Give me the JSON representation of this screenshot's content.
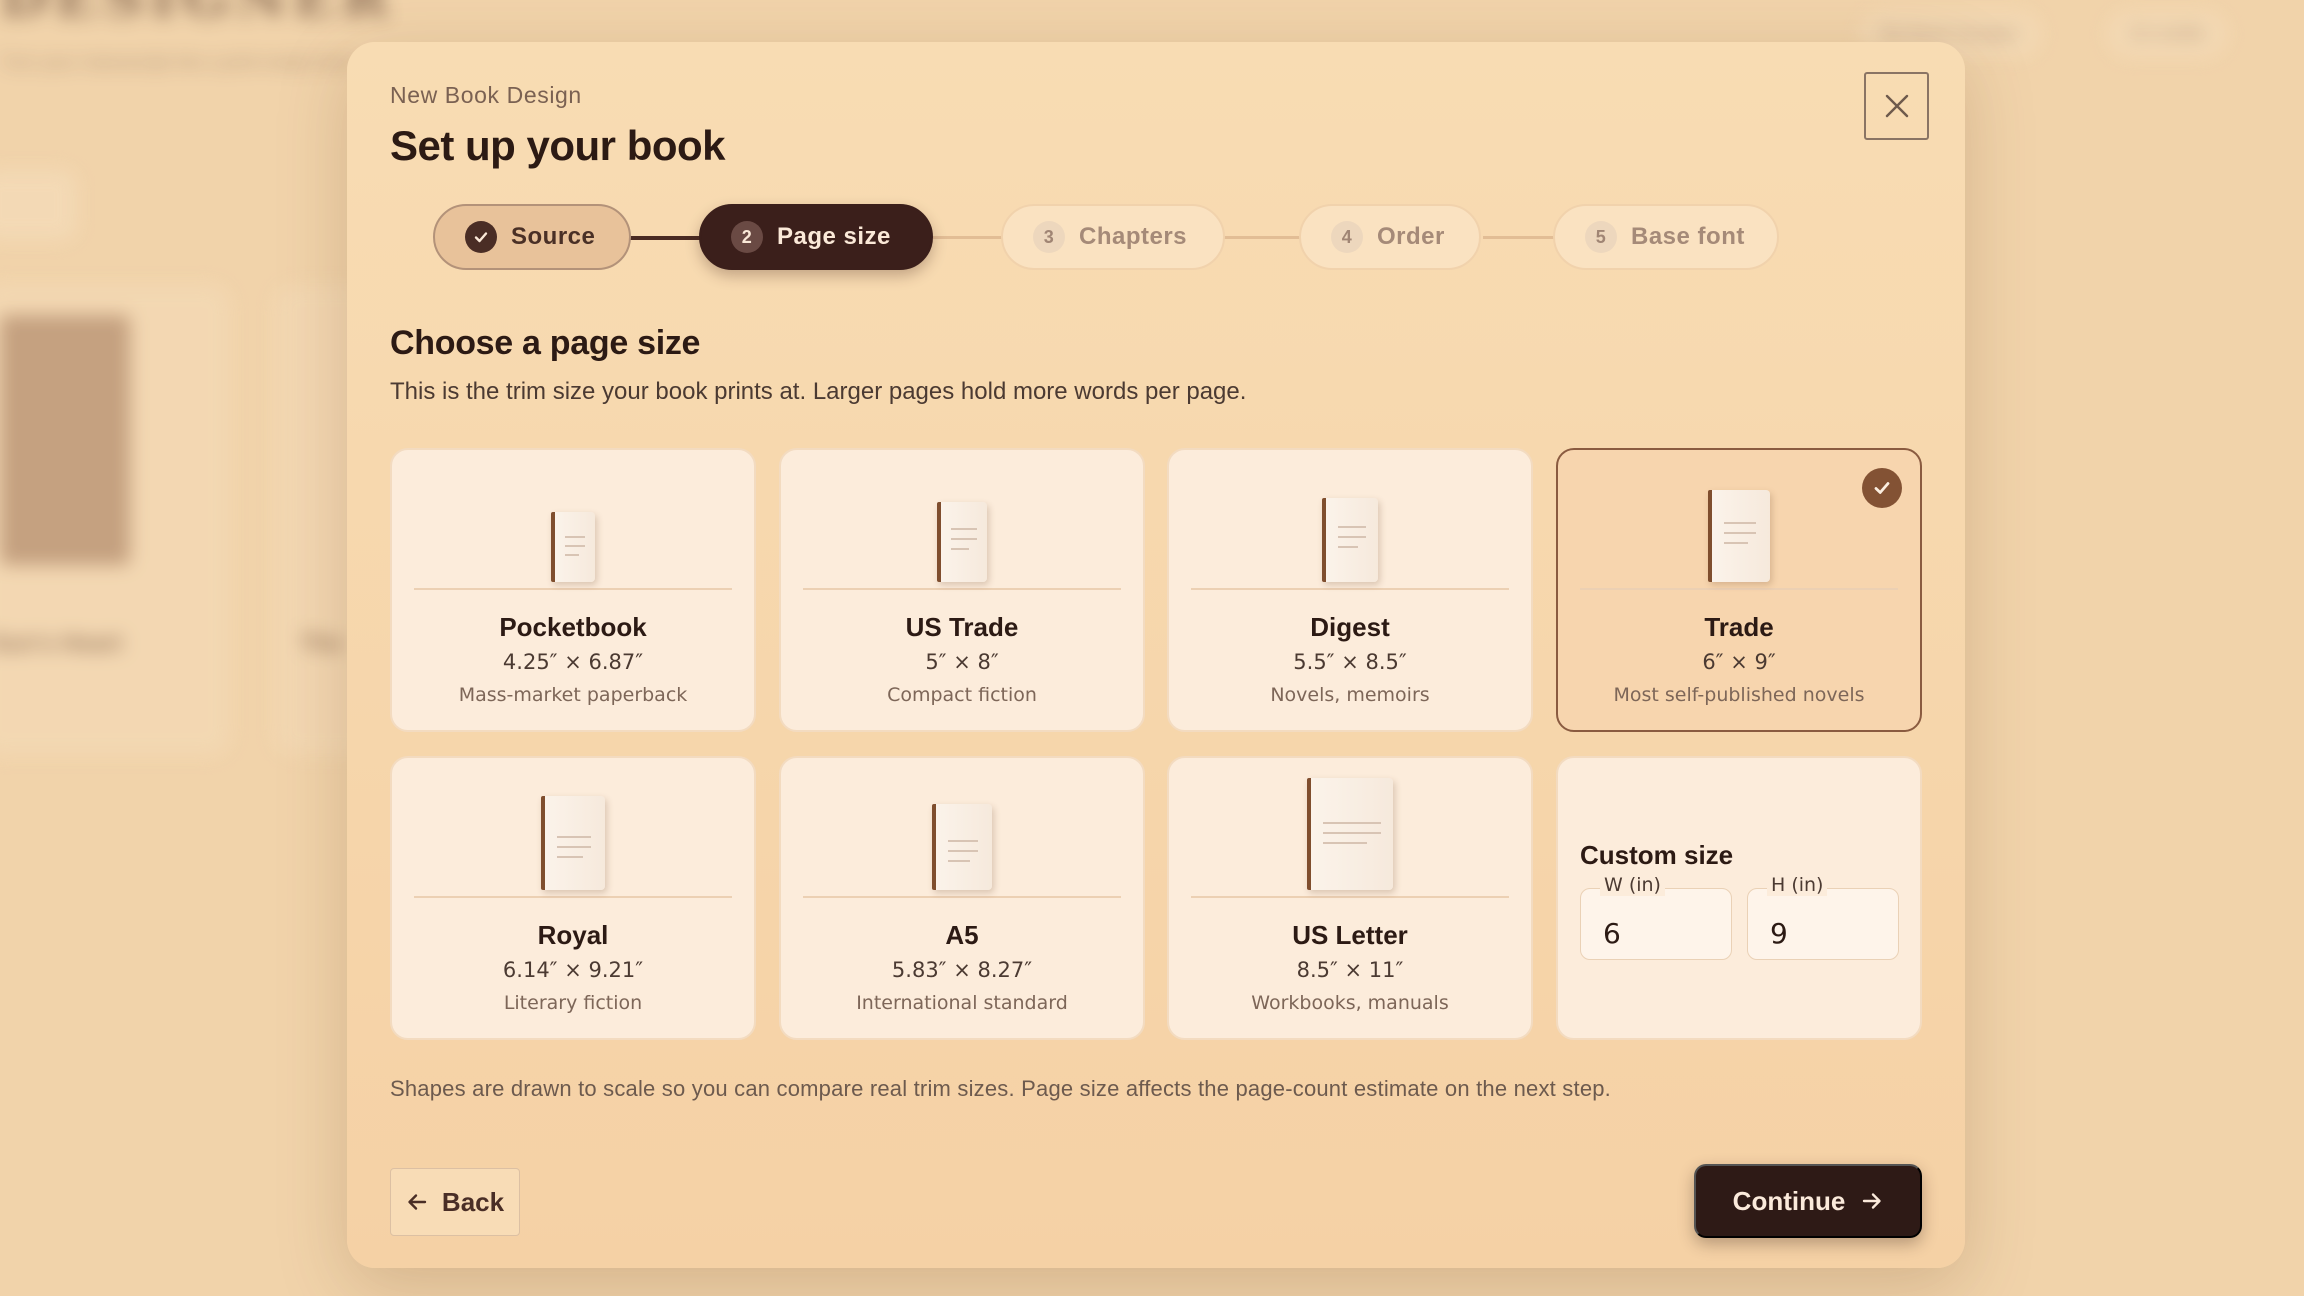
{
  "background": {
    "brand": "DESIGNER",
    "tagline": "Turn your manuscript into a print-ready book",
    "nav_pill": "My Book Designs",
    "credits_pill": "10 credits",
    "card_titles": [
      "Sun's Heart",
      "The"
    ]
  },
  "modal": {
    "eyebrow": "New Book Design",
    "title": "Set up your book",
    "close_icon": "close-icon"
  },
  "stepper": {
    "steps": [
      {
        "number": "1",
        "label": "Source",
        "state": "completed"
      },
      {
        "number": "2",
        "label": "Page size",
        "state": "active"
      },
      {
        "number": "3",
        "label": "Chapters",
        "state": "upcoming"
      },
      {
        "number": "4",
        "label": "Order",
        "state": "upcoming"
      },
      {
        "number": "5",
        "label": "Base font",
        "state": "upcoming"
      }
    ]
  },
  "section": {
    "title": "Choose a page size",
    "description": "This is the trim size your book prints at. Larger pages hold more words per page."
  },
  "sizes": [
    {
      "name": "Pocketbook",
      "dims": "4.25″ × 6.87″",
      "note": "Mass-market paperback",
      "selected": false
    },
    {
      "name": "US Trade",
      "dims": "5″ × 8″",
      "note": "Compact fiction",
      "selected": false
    },
    {
      "name": "Digest",
      "dims": "5.5″ × 8.5″",
      "note": "Novels, memoirs",
      "selected": false
    },
    {
      "name": "Trade",
      "dims": "6″ × 9″",
      "note": "Most self-published novels",
      "selected": true
    },
    {
      "name": "Royal",
      "dims": "6.14″ × 9.21″",
      "note": "Literary fiction",
      "selected": false
    },
    {
      "name": "A5",
      "dims": "5.83″ × 8.27″",
      "note": "International standard",
      "selected": false
    },
    {
      "name": "US Letter",
      "dims": "8.5″ × 11″",
      "note": "Workbooks, manuals",
      "selected": false
    }
  ],
  "custom": {
    "title": "Custom size",
    "width_label": "W (in)",
    "width_value": "6",
    "height_label": "H (in)",
    "height_value": "9"
  },
  "footnote": "Shapes are drawn to scale so you can compare real trim sizes. Page size affects the page-count estimate on the next step.",
  "actions": {
    "back_label": "Back",
    "continue_label": "Continue"
  },
  "colors": {
    "accent_dark": "#2e1a16",
    "selected_border": "#8a5b40",
    "check_badge": "#835234",
    "modal_bg": "#f7d8ae"
  }
}
